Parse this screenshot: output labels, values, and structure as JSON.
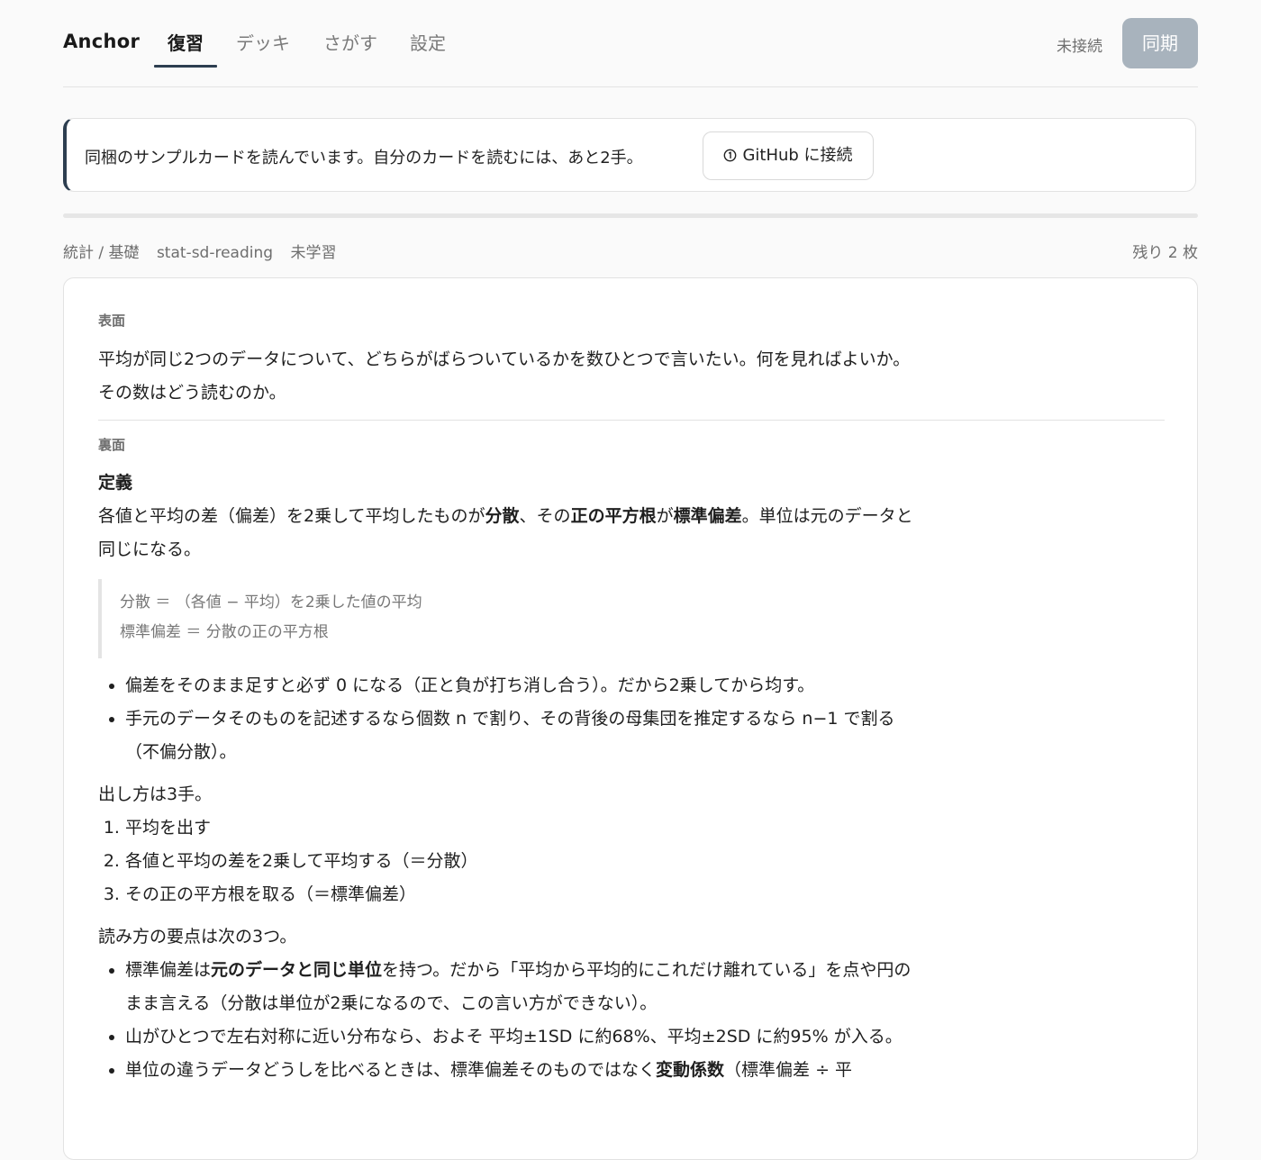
{
  "header": {
    "brand": "Anchor",
    "tabs": [
      {
        "label": "復習",
        "active": true
      },
      {
        "label": "デッキ",
        "active": false
      },
      {
        "label": "さがす",
        "active": false
      },
      {
        "label": "設定",
        "active": false
      }
    ],
    "connection_status": "未接続",
    "sync_label": "同期"
  },
  "banner": {
    "message": "同梱のサンプルカードを読んでいます。自分のカードを読むには、あと2手。",
    "button_label": "GitHub に接続",
    "button_icon": "info-circle-icon"
  },
  "progress": {
    "fraction": 0.0
  },
  "meta": {
    "deck_path": "統計 / 基礎",
    "card_id": "stat-sd-reading",
    "status": "未学習",
    "remaining": "残り 2 枚"
  },
  "card": {
    "front_label": "表面",
    "front_text": "平均が同じ2つのデータについて、どちらがばらついているかを数ひとつで言いたい。何を見ればよいか。その数はどう読むのか。",
    "back_label": "裏面",
    "definition_heading": "定義",
    "definition": {
      "t1": "各値と平均の差（偏差）を2乗して平均したものが",
      "b1": "分散",
      "t2": "、その",
      "b2": "正の平方根",
      "t3": "が",
      "b3": "標準偏差",
      "t4": "。単位は元のデータと同じになる。"
    },
    "formulas": [
      "分散 ＝ （各値 − 平均）を2乗した値の平均",
      "標準偏差 ＝ 分散の正の平方根"
    ],
    "notes": [
      "偏差をそのまま足すと必ず 0 になる（正と負が打ち消し合う）。だから2乗してから均す。",
      "手元のデータそのものを記述するなら個数 n で割り、その背後の母集団を推定するなら n−1 で割る（不偏分散）。"
    ],
    "steps_intro": "出し方は3手。",
    "steps": [
      "平均を出す",
      "各値と平均の差を2乗して平均する（＝分散）",
      "その正の平方根を取る（＝標準偏差）"
    ],
    "reading_intro": "読み方の要点は次の3つ。",
    "reading": {
      "r1_t1": "標準偏差は",
      "r1_b1": "元のデータと同じ単位",
      "r1_t2": "を持つ。だから「平均から平均的にこれだけ離れている」を点や円のまま言える（分散は単位が2乗になるので、この言い方ができない）。",
      "r2": "山がひとつで左右対称に近い分布なら、およそ 平均±1SD に約68%、平均±2SD に約95% が入る。",
      "r3_t1": "単位の違うデータどうしを比べるときは、標準偏差そのものではなく",
      "r3_b1": "変動係数",
      "r3_t2": "（標準偏差 ÷ 平"
    }
  }
}
